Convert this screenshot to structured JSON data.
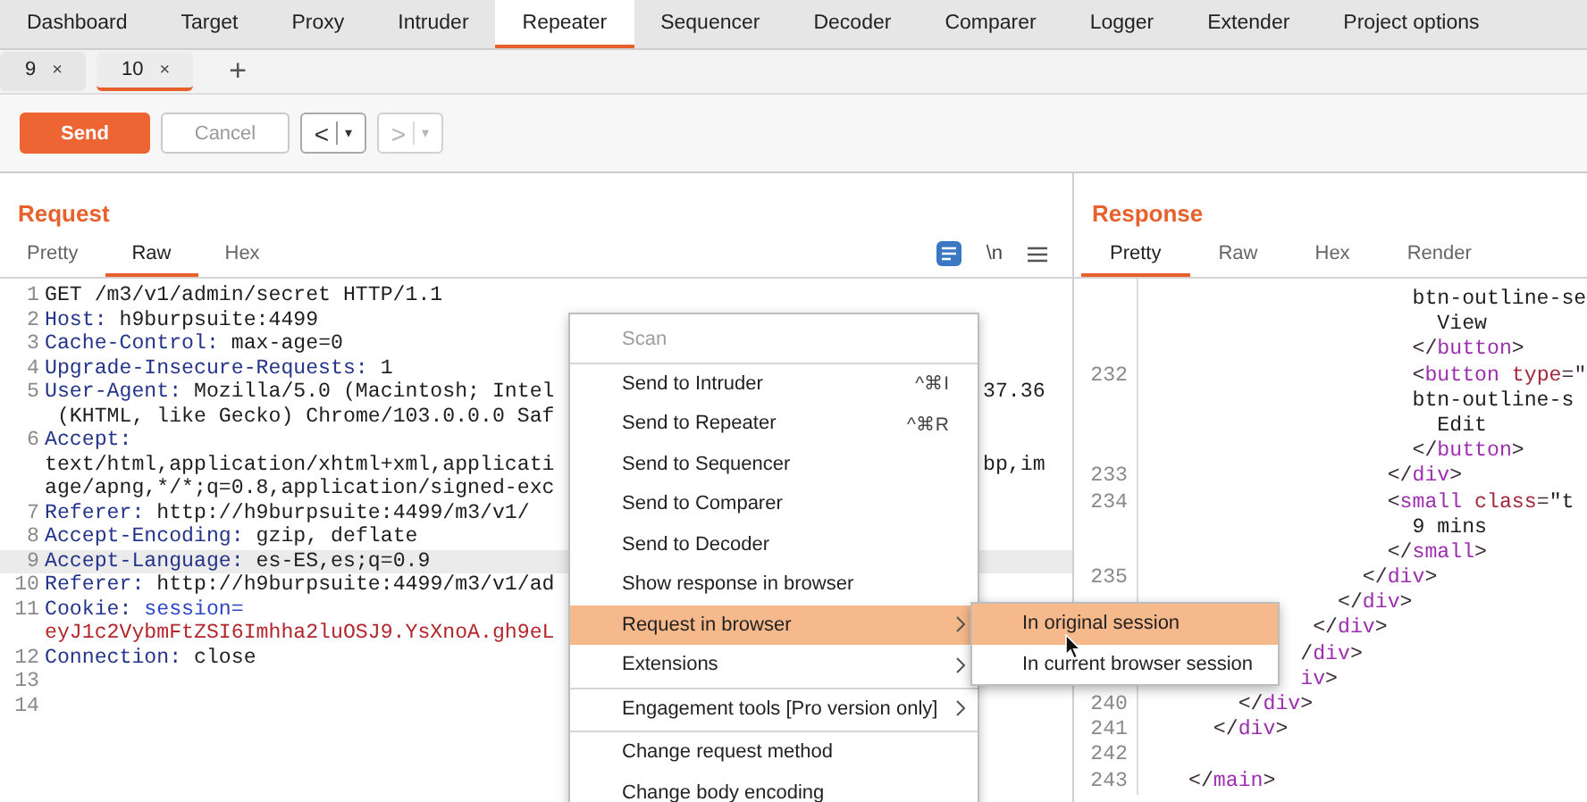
{
  "main_tabs": [
    {
      "label": "Dashboard",
      "selected": false
    },
    {
      "label": "Target",
      "selected": false
    },
    {
      "label": "Proxy",
      "selected": false
    },
    {
      "label": "Intruder",
      "selected": false
    },
    {
      "label": "Repeater",
      "selected": true
    },
    {
      "label": "Sequencer",
      "selected": false
    },
    {
      "label": "Decoder",
      "selected": false
    },
    {
      "label": "Comparer",
      "selected": false
    },
    {
      "label": "Logger",
      "selected": false
    },
    {
      "label": "Extender",
      "selected": false
    },
    {
      "label": "Project options",
      "selected": false
    }
  ],
  "sub_tabs": [
    {
      "label": "9",
      "close": "×",
      "selected": false
    },
    {
      "label": "10",
      "close": "×",
      "selected": true
    }
  ],
  "add_tab": "+",
  "toolbar": {
    "send": "Send",
    "cancel": {
      "label": "Cancel",
      "disabled": true
    },
    "back": {
      "arrow": "<",
      "caret": "▾",
      "disabled": false
    },
    "forward": {
      "arrow": ">",
      "caret": "▾",
      "disabled": true
    }
  },
  "request": {
    "title": "Request",
    "newline_toggle": "\\n",
    "tabs": [
      {
        "label": "Pretty",
        "selected": false
      },
      {
        "label": "Raw",
        "selected": true
      },
      {
        "label": "Hex",
        "selected": false
      }
    ],
    "rows": [
      {
        "number": "1",
        "highlighted": false,
        "tokens": [
          {
            "kind": "value",
            "text": "GET /m3/v1/admin/secret HTTP/1.1"
          }
        ]
      },
      {
        "number": "2",
        "highlighted": false,
        "tokens": [
          {
            "kind": "name",
            "text": "Host:"
          },
          {
            "kind": "value",
            "text": " h9burpsuite:4499"
          }
        ]
      },
      {
        "number": "3",
        "highlighted": false,
        "tokens": [
          {
            "kind": "name",
            "text": "Cache-Control:"
          },
          {
            "kind": "value",
            "text": " max-age=0"
          }
        ]
      },
      {
        "number": "4",
        "highlighted": false,
        "tokens": [
          {
            "kind": "name",
            "text": "Upgrade-Insecure-Requests:"
          },
          {
            "kind": "value",
            "text": " 1"
          }
        ]
      },
      {
        "number": "5",
        "highlighted": false,
        "tokens": [
          {
            "kind": "name",
            "text": "User-Agent:"
          },
          {
            "kind": "value",
            "text": " Mozilla/5.0 (Macintosh; Intel"
          }
        ],
        "tail": "37.36"
      },
      {
        "highlighted": false,
        "tokens": [
          {
            "kind": "value",
            "text": " (KHTML, like Gecko) Chrome/103.0.0.0 Saf"
          }
        ]
      },
      {
        "number": "6",
        "highlighted": false,
        "tokens": [
          {
            "kind": "name",
            "text": "Accept:"
          }
        ]
      },
      {
        "highlighted": false,
        "tokens": [
          {
            "kind": "value",
            "text": "text/html,application/xhtml+xml,applicati"
          }
        ],
        "tail": "bp,im"
      },
      {
        "highlighted": false,
        "tokens": [
          {
            "kind": "value",
            "text": "age/apng,*/*;q=0.8,application/signed-exc"
          }
        ]
      },
      {
        "number": "7",
        "highlighted": false,
        "tokens": [
          {
            "kind": "name",
            "text": "Referer:"
          },
          {
            "kind": "value",
            "text": " http://h9burpsuite:4499/m3/v1/"
          }
        ]
      },
      {
        "number": "8",
        "highlighted": false,
        "tokens": [
          {
            "kind": "name",
            "text": "Accept-Encoding:"
          },
          {
            "kind": "value",
            "text": " gzip, deflate"
          }
        ]
      },
      {
        "number": "9",
        "highlighted": true,
        "tokens": [
          {
            "kind": "name",
            "text": "Accept-Language:"
          },
          {
            "kind": "value",
            "text": " es-ES,es;q=0.9"
          }
        ]
      },
      {
        "number": "10",
        "highlighted": false,
        "tokens": [
          {
            "kind": "name",
            "text": "Referer:"
          },
          {
            "kind": "value",
            "text": " http://h9burpsuite:4499/m3/v1/ad"
          }
        ]
      },
      {
        "number": "11",
        "highlighted": false,
        "tokens": [
          {
            "kind": "name",
            "text": "Cookie:"
          },
          {
            "kind": "param",
            "text": " session="
          }
        ]
      },
      {
        "highlighted": false,
        "tokens": [
          {
            "kind": "cookie",
            "text": "eyJ1c2VybmFtZSI6Imhha2luOSJ9.YsXnoA.gh9eL"
          }
        ]
      },
      {
        "number": "12",
        "highlighted": false,
        "tokens": [
          {
            "kind": "name",
            "text": "Connection:"
          },
          {
            "kind": "value",
            "text": " close"
          }
        ]
      },
      {
        "number": "13",
        "highlighted": false,
        "tokens": []
      },
      {
        "number": "14",
        "highlighted": false,
        "tokens": []
      }
    ]
  },
  "response": {
    "title": "Response",
    "tabs": [
      {
        "label": "Pretty",
        "selected": true
      },
      {
        "label": "Raw",
        "selected": false
      },
      {
        "label": "Hex",
        "selected": false
      },
      {
        "label": "Render",
        "selected": false
      }
    ],
    "rows": [
      {
        "tokens": [
          {
            "kind": "value",
            "text": "                  btn-outline-se"
          }
        ]
      },
      {
        "tokens": [
          {
            "kind": "text",
            "text": "                    View"
          }
        ]
      },
      {
        "tokens": [
          {
            "kind": "punct",
            "text": "                  </"
          },
          {
            "kind": "tag",
            "text": "button"
          },
          {
            "kind": "punct",
            "text": ">"
          }
        ]
      },
      {
        "number": "232",
        "tokens": [
          {
            "kind": "punct",
            "text": "                  <"
          },
          {
            "kind": "tag",
            "text": "button"
          },
          {
            "kind": "attr",
            "text": " type"
          },
          {
            "kind": "punct",
            "text": "=\""
          }
        ]
      },
      {
        "tokens": [
          {
            "kind": "value",
            "text": "                  btn-outline-s"
          }
        ]
      },
      {
        "tokens": [
          {
            "kind": "text",
            "text": "                    Edit"
          }
        ]
      },
      {
        "tokens": [
          {
            "kind": "punct",
            "text": "                  </"
          },
          {
            "kind": "tag",
            "text": "button"
          },
          {
            "kind": "punct",
            "text": ">"
          }
        ]
      },
      {
        "number": "233",
        "tokens": [
          {
            "kind": "punct",
            "text": "                </"
          },
          {
            "kind": "tag",
            "text": "div"
          },
          {
            "kind": "punct",
            "text": ">"
          }
        ]
      },
      {
        "number": "234",
        "tokens": [
          {
            "kind": "punct",
            "text": "                <"
          },
          {
            "kind": "tag",
            "text": "small"
          },
          {
            "kind": "attr",
            "text": " class"
          },
          {
            "kind": "punct",
            "text": "="
          },
          {
            "kind": "value",
            "text": "\"t"
          }
        ]
      },
      {
        "tokens": [
          {
            "kind": "text",
            "text": "                  9 mins"
          }
        ]
      },
      {
        "tokens": [
          {
            "kind": "punct",
            "text": "                </"
          },
          {
            "kind": "tag",
            "text": "small"
          },
          {
            "kind": "punct",
            "text": ">"
          }
        ]
      },
      {
        "number": "235",
        "tokens": [
          {
            "kind": "punct",
            "text": "              </"
          },
          {
            "kind": "tag",
            "text": "div"
          },
          {
            "kind": "punct",
            "text": ">"
          }
        ]
      },
      {
        "tokens": [
          {
            "kind": "punct",
            "text": "            </"
          },
          {
            "kind": "tag",
            "text": "div"
          },
          {
            "kind": "punct",
            "text": ">"
          }
        ]
      },
      {
        "tokens": [
          {
            "kind": "punct",
            "text": "          </"
          },
          {
            "kind": "tag",
            "text": "div"
          },
          {
            "kind": "punct",
            "text": ">"
          }
        ]
      },
      {
        "tokens": [
          {
            "kind": "punct",
            "text": "         /"
          },
          {
            "kind": "tag",
            "text": "div"
          },
          {
            "kind": "punct",
            "text": ">"
          }
        ]
      },
      {
        "tokens": [
          {
            "kind": "tag",
            "text": "         iv"
          },
          {
            "kind": "punct",
            "text": ">"
          }
        ]
      },
      {
        "number": "240",
        "tokens": [
          {
            "kind": "punct",
            "text": "    </"
          },
          {
            "kind": "tag",
            "text": "div"
          },
          {
            "kind": "punct",
            "text": ">"
          }
        ]
      },
      {
        "number": "241",
        "tokens": [
          {
            "kind": "punct",
            "text": "  </"
          },
          {
            "kind": "tag",
            "text": "div"
          },
          {
            "kind": "punct",
            "text": ">"
          }
        ]
      },
      {
        "number": "242",
        "tokens": []
      },
      {
        "number": "243",
        "tokens": [
          {
            "kind": "punct",
            "text": "</"
          },
          {
            "kind": "tag",
            "text": "main"
          },
          {
            "kind": "punct",
            "text": ">"
          }
        ]
      }
    ]
  },
  "context_menu": {
    "items": [
      {
        "label": "Scan",
        "disabled": true,
        "selected": false,
        "submenu": false,
        "separator_after": true
      },
      {
        "label": "Send to Intruder",
        "shortcut": "^⌘I",
        "disabled": false,
        "selected": false,
        "submenu": false,
        "separator_after": false
      },
      {
        "label": "Send to Repeater",
        "shortcut": "^⌘R",
        "disabled": false,
        "selected": false,
        "submenu": false,
        "separator_after": false
      },
      {
        "label": "Send to Sequencer",
        "disabled": false,
        "selected": false,
        "submenu": false,
        "separator_after": false
      },
      {
        "label": "Send to Comparer",
        "disabled": false,
        "selected": false,
        "submenu": false,
        "separator_after": false
      },
      {
        "label": "Send to Decoder",
        "disabled": false,
        "selected": false,
        "submenu": false,
        "separator_after": false
      },
      {
        "label": "Show response in browser",
        "disabled": false,
        "selected": false,
        "submenu": false,
        "separator_after": false
      },
      {
        "label": "Request in browser",
        "disabled": false,
        "selected": true,
        "submenu": true,
        "separator_after": false
      },
      {
        "label": "Extensions",
        "disabled": false,
        "selected": false,
        "submenu": true,
        "separator_after": true
      },
      {
        "label": "Engagement tools [Pro version only]",
        "disabled": false,
        "selected": false,
        "submenu": true,
        "separator_after": true
      },
      {
        "label": "Change request method",
        "disabled": false,
        "selected": false,
        "submenu": false,
        "separator_after": false
      },
      {
        "label": "Change body encoding",
        "disabled": false,
        "selected": false,
        "submenu": false,
        "separator_after": false
      }
    ]
  },
  "submenu": {
    "items": [
      {
        "label": "In original session",
        "selected": true
      },
      {
        "label": "In current browser session",
        "selected": false
      }
    ]
  }
}
